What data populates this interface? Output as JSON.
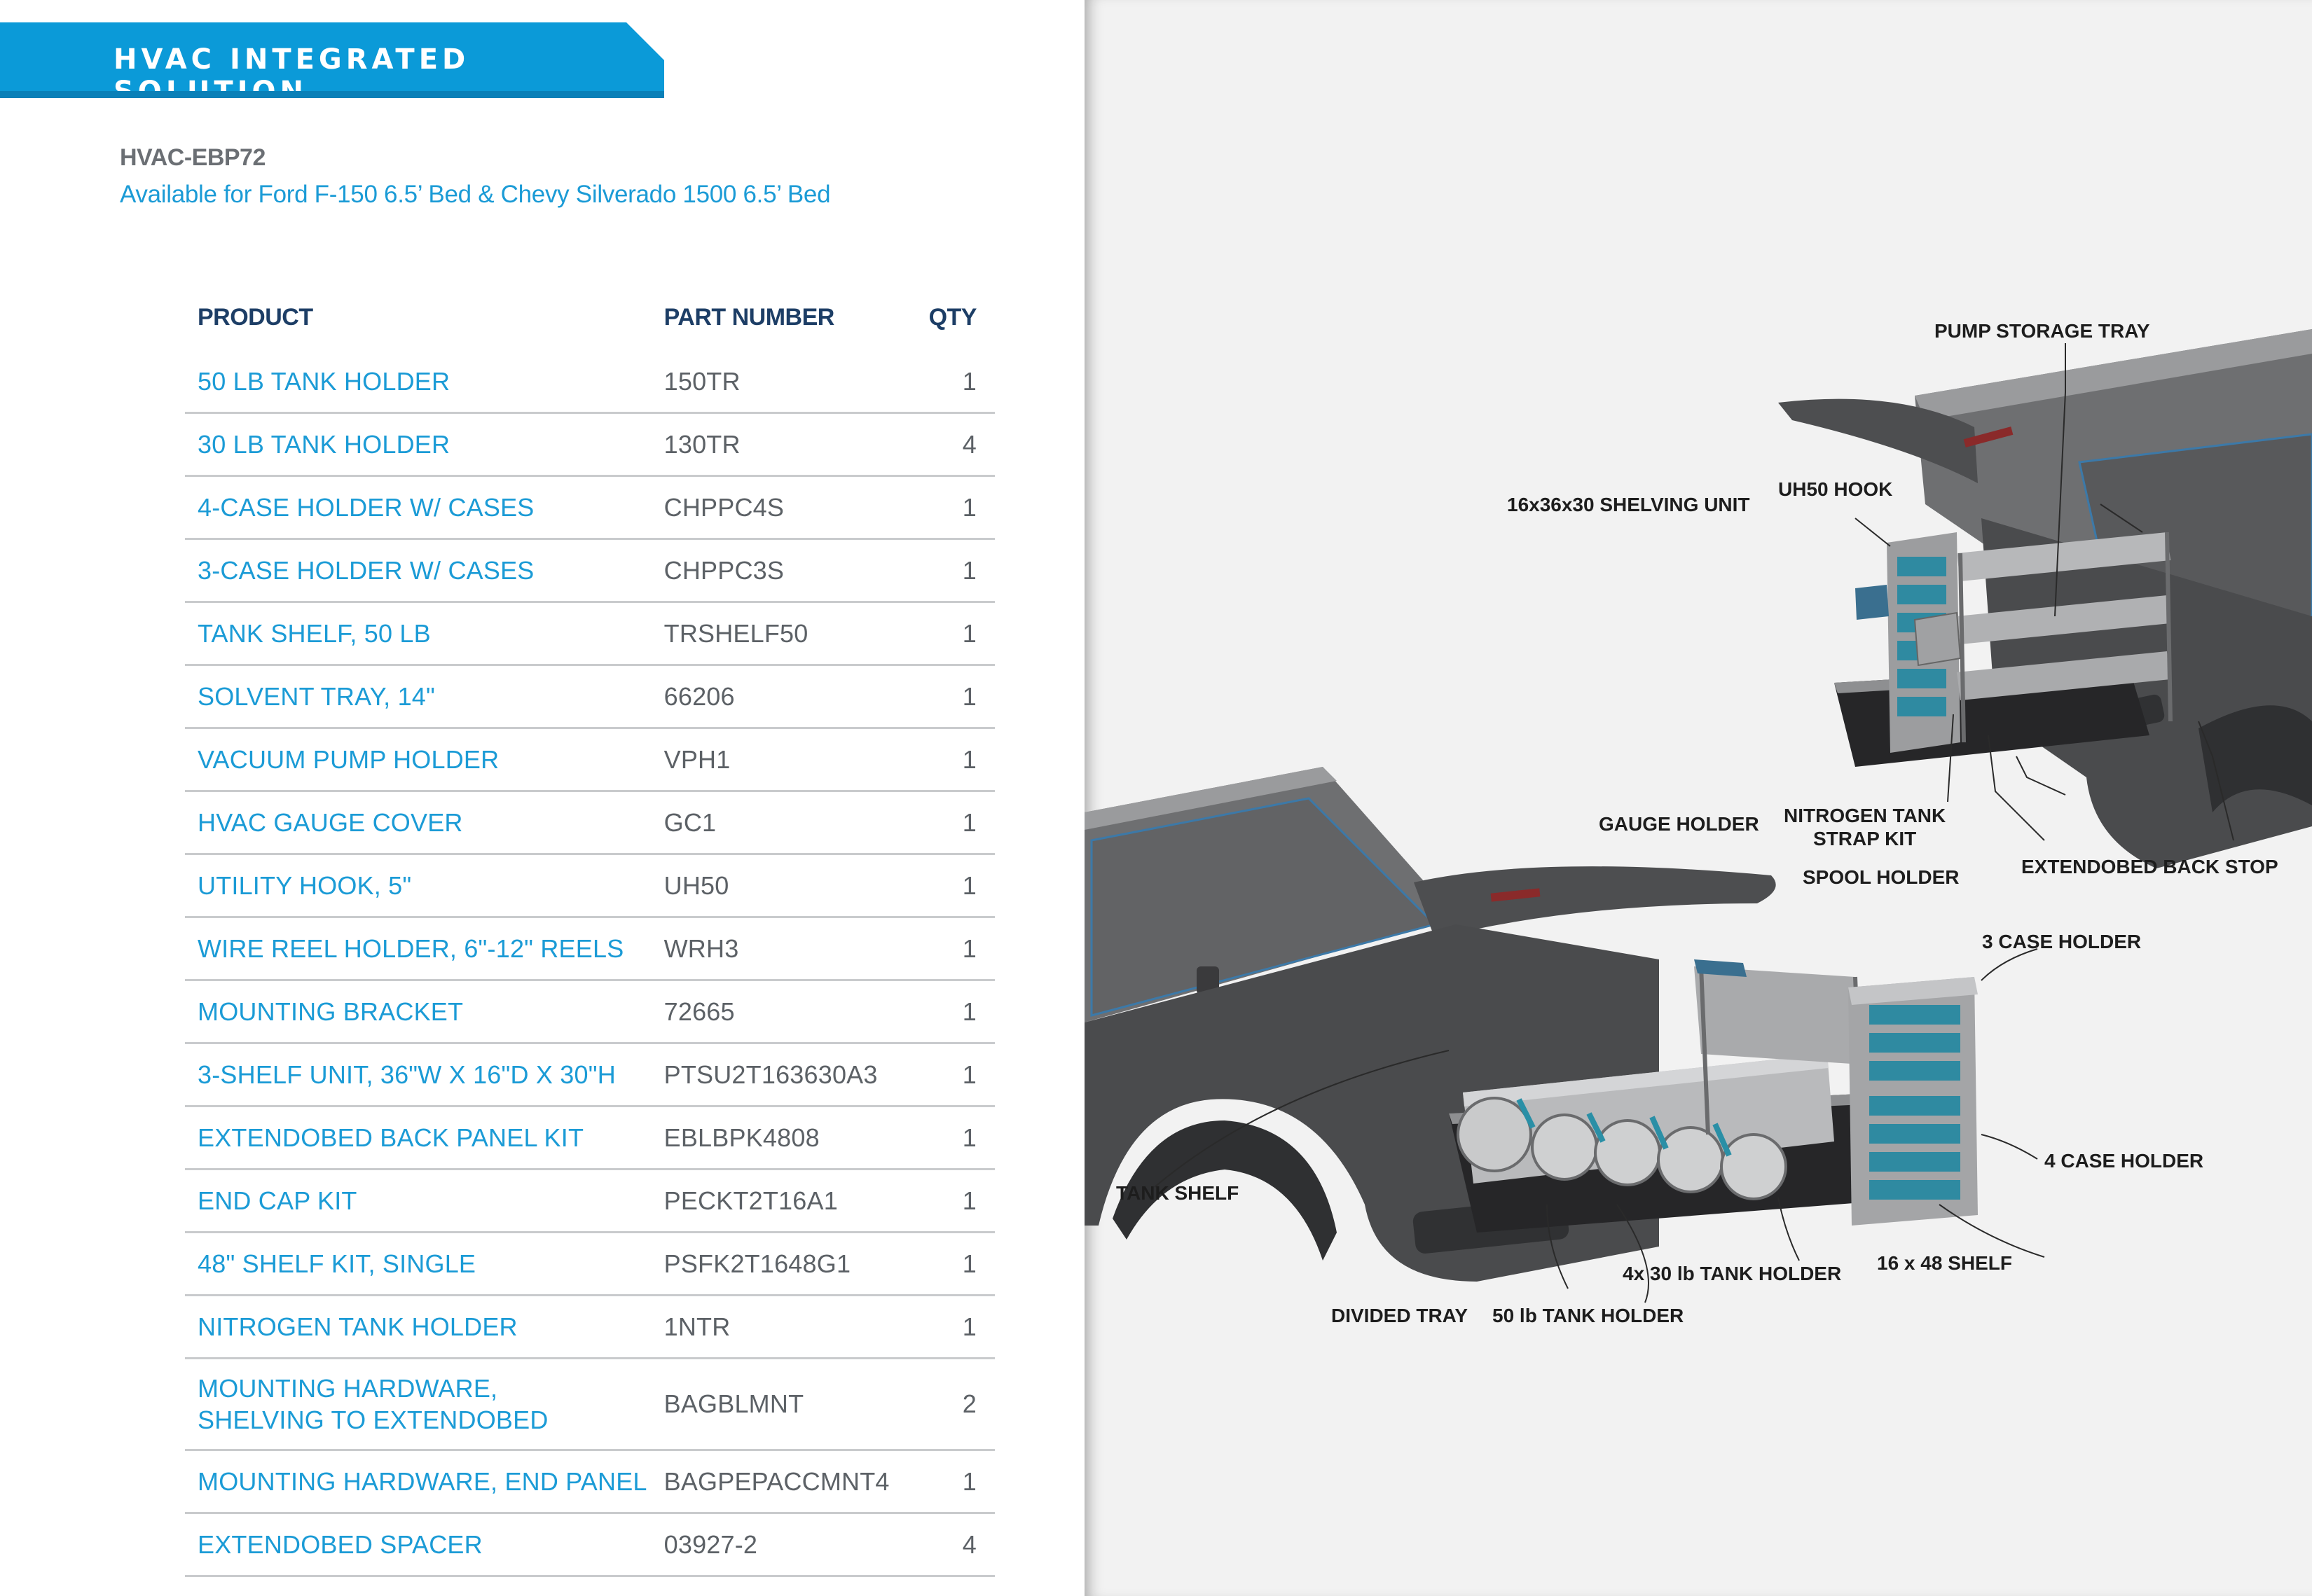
{
  "header": {
    "banner_title": "HVAC INTEGRATED SOLUTION",
    "model": "HVAC-EBP72",
    "availability": "Available for Ford F-150 6.5’ Bed & Chevy Silverado 1500 6.5’ Bed"
  },
  "table": {
    "columns": {
      "product": "PRODUCT",
      "part_number": "PART NUMBER",
      "qty": "QTY"
    },
    "rows": [
      {
        "product": "50 LB TANK HOLDER",
        "part_number": "150TR",
        "qty": "1"
      },
      {
        "product": "30 LB TANK HOLDER",
        "part_number": "130TR",
        "qty": "4"
      },
      {
        "product": "4-CASE HOLDER W/ CASES",
        "part_number": "CHPPC4S",
        "qty": "1"
      },
      {
        "product": "3-CASE HOLDER W/ CASES",
        "part_number": "CHPPC3S",
        "qty": "1"
      },
      {
        "product": "TANK SHELF, 50 LB",
        "part_number": "TRSHELF50",
        "qty": "1"
      },
      {
        "product": "SOLVENT TRAY, 14\"",
        "part_number": "66206",
        "qty": "1"
      },
      {
        "product": "VACUUM PUMP HOLDER",
        "part_number": "VPH1",
        "qty": "1"
      },
      {
        "product": "HVAC GAUGE COVER",
        "part_number": "GC1",
        "qty": "1"
      },
      {
        "product": "UTILITY HOOK, 5\"",
        "part_number": "UH50",
        "qty": "1"
      },
      {
        "product": "WIRE REEL HOLDER, 6\"-12\" REELS",
        "part_number": "WRH3",
        "qty": "1"
      },
      {
        "product": "MOUNTING BRACKET",
        "part_number": "72665",
        "qty": "1"
      },
      {
        "product": "3-SHELF UNIT, 36\"W X 16\"D X 30\"H",
        "part_number": "PTSU2T163630A3",
        "qty": "1"
      },
      {
        "product": "EXTENDOBED BACK PANEL KIT",
        "part_number": "EBLBPK4808",
        "qty": "1"
      },
      {
        "product": "END CAP KIT",
        "part_number": "PECKT2T16A1",
        "qty": "1"
      },
      {
        "product": "48\" SHELF KIT, SINGLE",
        "part_number": "PSFK2T1648G1",
        "qty": "1"
      },
      {
        "product": "NITROGEN TANK HOLDER",
        "part_number": "1NTR",
        "qty": "1"
      },
      {
        "product": "MOUNTING HARDWARE,\nSHELVING TO EXTENDOBED",
        "product_line1": "MOUNTING HARDWARE,",
        "product_line2": "SHELVING TO EXTENDOBED",
        "part_number": "BAGBLMNT",
        "qty": "2"
      },
      {
        "product": "MOUNTING HARDWARE, END PANEL",
        "part_number": "BAGPEPACCMNT4",
        "qty": "1"
      },
      {
        "product": "EXTENDOBED SPACER",
        "part_number": "03927-2",
        "qty": "4"
      }
    ]
  },
  "diagram": {
    "callouts": {
      "pump_storage_tray": "PUMP STORAGE TRAY",
      "uh50_hook": "UH50 HOOK",
      "shelving_unit": "16x36x30 SHELVING UNIT",
      "gauge_holder": "GAUGE HOLDER",
      "nitrogen_strap_line1": "NITROGEN TANK",
      "nitrogen_strap_line2": "STRAP KIT",
      "spool_holder": "SPOOL HOLDER",
      "extendobed_back_stop": "EXTENDOBED BACK STOP",
      "three_case_holder": "3 CASE HOLDER",
      "four_case_holder": "4 CASE HOLDER",
      "tank_shelf": "TANK SHELF",
      "tank_holder_30": "4x 30 lb TANK HOLDER",
      "shelf_16x48": "16 x 48 SHELF",
      "divided_tray": "DIVIDED TRAY",
      "tank_holder_50": "50 lb TANK HOLDER"
    }
  },
  "colors": {
    "brand_blue": "#0b9ad8",
    "navy": "#1d3e66",
    "teal_accent": "#2a8fa6"
  }
}
